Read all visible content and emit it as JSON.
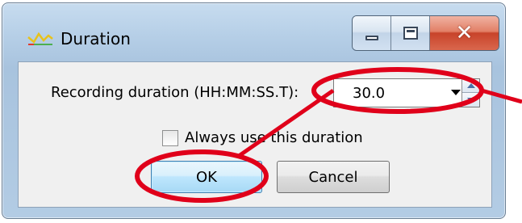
{
  "window": {
    "title": "Duration",
    "icon": "waveform-icon",
    "caption_buttons": [
      "minimize-icon",
      "maximize-icon",
      "close-icon"
    ]
  },
  "form": {
    "duration_label": "Recording duration (HH:MM:SS.T):",
    "duration_value": "30.0",
    "always_use_label": "Always use this duration",
    "always_use_checked": false
  },
  "buttons": {
    "ok_label": "OK",
    "cancel_label": "Cancel"
  },
  "annotation": {
    "color": "#e0001a",
    "targets": [
      "duration-combo",
      "ok-button"
    ]
  },
  "colors": {
    "titlebar": "#b6cfe7",
    "client_bg": "#f0f0f0",
    "close_button": "#c8432a",
    "default_button_border": "#3c7fb1"
  }
}
